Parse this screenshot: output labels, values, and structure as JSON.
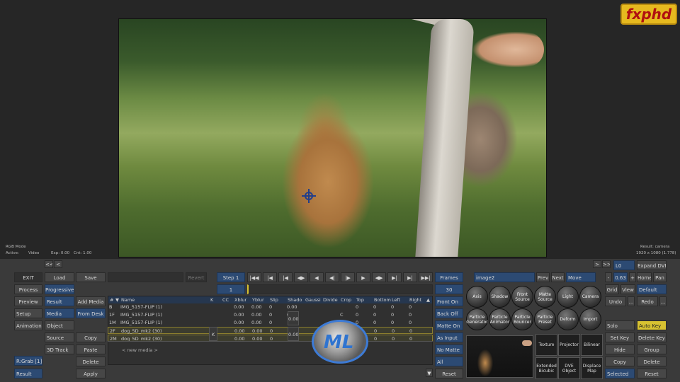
{
  "viewer": {
    "logo": "fxphd",
    "left_info": {
      "mode": "RGB Mode",
      "active_label": "Active:",
      "active_value": "Video",
      "exp": "Exp: 0.00",
      "cnt": "Cnt: 1.00"
    },
    "right_info": {
      "result": "Result: camera",
      "res": "1920 x 1080 (1.778)"
    }
  },
  "nav_arrows": {
    "left1": "<<",
    "left2": "<",
    "right1": ">",
    "right2": ">>"
  },
  "left_col": [
    "EXIT",
    "Process",
    "Preview",
    "Setup",
    "Animation",
    "R:Grab [1]",
    "Result"
  ],
  "left_col2": [
    "Load",
    "Progressive",
    "Result",
    "Media",
    "Object",
    "Source",
    "3D Track"
  ],
  "left_col3": [
    "Save",
    "Add Media",
    "From Desk",
    "Copy",
    "Paste",
    "Delete",
    "Apply"
  ],
  "toolbar": {
    "revert": "Revert",
    "step": "Step 1",
    "frame": "1",
    "frames": "Frames",
    "frames_val": "30"
  },
  "table": {
    "headers": [
      "#",
      "Name",
      "K",
      "CC",
      "Xblur",
      "Yblur",
      "Slip",
      "Shado",
      "Gaussi",
      "Divide",
      "Crop",
      "Top",
      "Bottom",
      "Left",
      "Right"
    ],
    "rows": [
      {
        "id": "B",
        "name": "IMG_5157-FLIP (1)",
        "xb": "0.00",
        "yb": "0.00",
        "slip": "0",
        "sh": "0.00",
        "crop": "",
        "top": "0",
        "bot": "0",
        "left": "0",
        "right": "0"
      },
      {
        "id": "1F",
        "name": "IMG_5157-FLIP (1)",
        "xb": "0.00",
        "yb": "0.00",
        "slip": "0",
        "sh": "0.00",
        "crop": "C",
        "top": "0",
        "bot": "0",
        "left": "0",
        "right": "0"
      },
      {
        "id": "1M",
        "name": "IMG_5157-FLIP (1)",
        "xb": "0.00",
        "yb": "0.00",
        "slip": "0",
        "sh": "",
        "crop": "",
        "top": "0",
        "bot": "0",
        "left": "0",
        "right": "0"
      },
      {
        "id": "2F",
        "name": "dog_5D_mk2 (30)",
        "xb": "0.00",
        "yb": "0.00",
        "slip": "0",
        "sh": "0.00",
        "crop": "C",
        "top": "0",
        "bot": "0",
        "left": "0",
        "right": "0"
      },
      {
        "id": "2M",
        "name": "dog_5D_mk2 (30)",
        "xb": "0.00",
        "yb": "0.00",
        "slip": "0",
        "sh": "",
        "crop": "S",
        "top": "0",
        "bot": "0",
        "left": "0",
        "right": "0"
      }
    ],
    "k_mark": "K",
    "new_media": "< new media >"
  },
  "mid_col": [
    "Front On",
    "Back Off",
    "Matte On",
    "As Input",
    "No Matte",
    "All",
    "Reset"
  ],
  "node": {
    "name": "image2",
    "prev": "Prev",
    "next": "Next",
    "move": "Move"
  },
  "tools_row1": [
    "Axis",
    "Shadow",
    "Front Source",
    "Matte Source",
    "Light",
    "Camera"
  ],
  "tools_row2": [
    "Particle Generator",
    "Particle Animator",
    "Particle Bouncer",
    "Particle Preset",
    "Deform",
    "Import"
  ],
  "tools_sq": [
    "Texture",
    "Projector",
    "Bilinear",
    "Extended Bicubic",
    "DVE Object",
    "Displace Map"
  ],
  "right_top": {
    "l0": "L0",
    "expand": "Expand DVE",
    "minus": "-",
    "zoom": "0.63",
    "plus": "+",
    "home": "Home",
    "pan": "Pan",
    "grid": "Grid",
    "view": "View",
    "default": "Default",
    "undo": "Undo",
    "redo": "Redo"
  },
  "right_col": [
    "Solo",
    "Set Key",
    "Hide",
    "Copy",
    "Selected"
  ],
  "right_col2": [
    "Auto Key",
    "Delete Key",
    "Group",
    "Delete",
    "Reset"
  ],
  "brand_overlay": "ML"
}
